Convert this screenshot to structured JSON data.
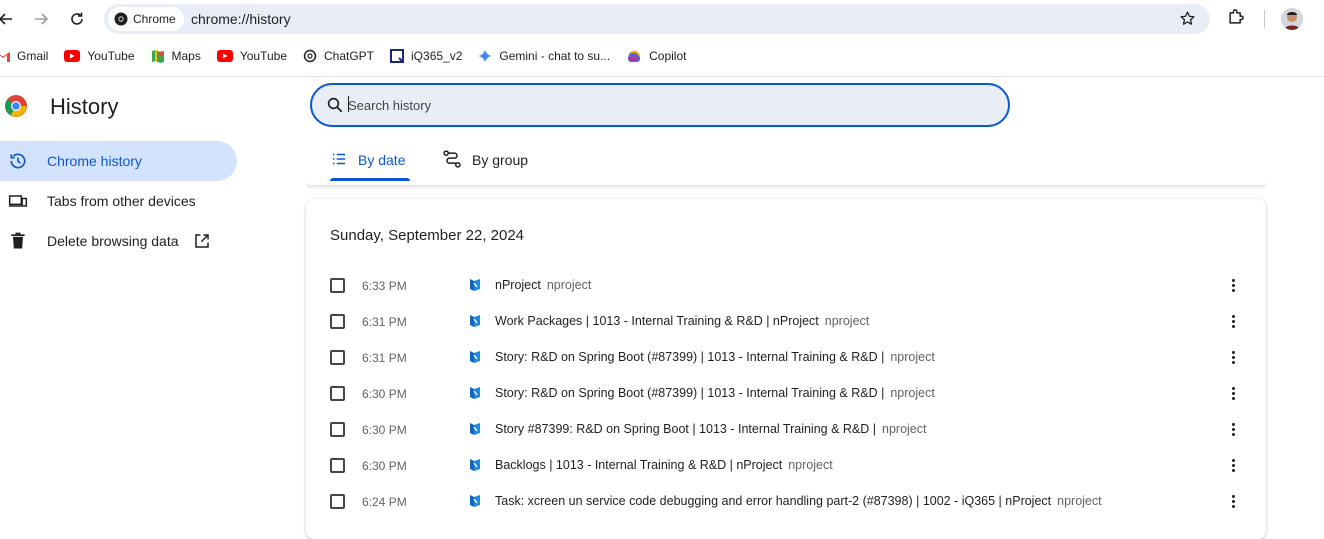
{
  "browser": {
    "chip_label": "Chrome",
    "url": "chrome://history"
  },
  "bookmarks": [
    {
      "label": "Gmail",
      "icon": "gmail-icon"
    },
    {
      "label": "YouTube",
      "icon": "youtube-icon"
    },
    {
      "label": "Maps",
      "icon": "maps-icon"
    },
    {
      "label": "YouTube",
      "icon": "youtube-icon"
    },
    {
      "label": "ChatGPT",
      "icon": "chatgpt-icon"
    },
    {
      "label": "iQ365_v2",
      "icon": "iq365-icon"
    },
    {
      "label": "Gemini - chat to su...",
      "icon": "gemini-icon"
    },
    {
      "label": "Copilot",
      "icon": "copilot-icon"
    }
  ],
  "sidebar": {
    "title": "History",
    "items": [
      {
        "label": "Chrome history",
        "icon": "history-clock-icon",
        "active": true
      },
      {
        "label": "Tabs from other devices",
        "icon": "devices-icon"
      },
      {
        "label": "Delete browsing data",
        "icon": "trash-icon"
      }
    ]
  },
  "search": {
    "placeholder": "Search history",
    "value": ""
  },
  "tabs": [
    {
      "label": "By date",
      "active": true
    },
    {
      "label": "By group",
      "active": false
    }
  ],
  "history": {
    "date": "Sunday, September 22, 2024",
    "rows": [
      {
        "time": "6:33 PM",
        "title": "nProject",
        "domain": "nproject"
      },
      {
        "time": "6:31 PM",
        "title": "Work Packages | 1013 - Internal Training & R&D | nProject",
        "domain": "nproject"
      },
      {
        "time": "6:31 PM",
        "title": "Story: R&D on Spring Boot (#87399) | 1013 - Internal Training & R&D |",
        "domain": "nproject"
      },
      {
        "time": "6:30 PM",
        "title": "Story: R&D on Spring Boot (#87399) | 1013 - Internal Training & R&D |",
        "domain": "nproject"
      },
      {
        "time": "6:30 PM",
        "title": "Story #87399: R&D on Spring Boot | 1013 - Internal Training & R&D |",
        "domain": "nproject"
      },
      {
        "time": "6:30 PM",
        "title": "Backlogs | 1013 - Internal Training & R&D | nProject",
        "domain": "nproject"
      },
      {
        "time": "6:24 PM",
        "title": "Task: xcreen un service code debugging and error handling part-2 (#87398) | 1002 - iQ365 | nProject",
        "domain": "nproject"
      }
    ]
  },
  "colors": {
    "accent": "#0b57d0",
    "active_bg": "#d3e3fd",
    "omnibox_bg": "#e9eef6"
  }
}
